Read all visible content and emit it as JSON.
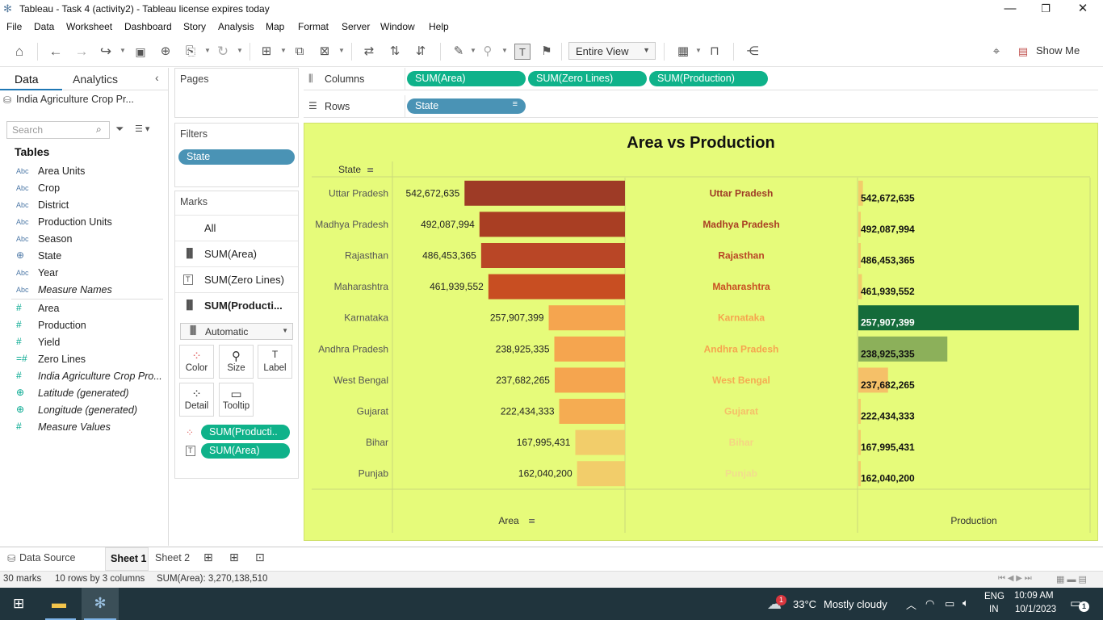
{
  "window": {
    "title": "Tableau - Task 4 (activity2) - Tableau license expires today",
    "minimize_glyph": "—",
    "restore_glyph": "❐",
    "close_glyph": "✕"
  },
  "menu": [
    "File",
    "Data",
    "Worksheet",
    "Dashboard",
    "Story",
    "Analysis",
    "Map",
    "Format",
    "Server",
    "Window",
    "Help"
  ],
  "toolbar": {
    "view_mode": "Entire View",
    "show_me": "Show Me"
  },
  "data_pane": {
    "tab_data": "Data",
    "tab_analytics": "Analytics",
    "datasource": "India Agriculture Crop Pr...",
    "search_placeholder": "Search",
    "tables_heading": "Tables",
    "dimensions": [
      {
        "type": "Abc",
        "name": "Area Units"
      },
      {
        "type": "Abc",
        "name": "Crop"
      },
      {
        "type": "Abc",
        "name": "District"
      },
      {
        "type": "Abc",
        "name": "Production Units"
      },
      {
        "type": "Abc",
        "name": "Season"
      },
      {
        "type": "geo",
        "name": "State"
      },
      {
        "type": "Abc",
        "name": "Year"
      },
      {
        "type": "Abc",
        "name": "Measure Names",
        "italic": true
      }
    ],
    "measures": [
      {
        "type": "#",
        "name": "Area"
      },
      {
        "type": "#",
        "name": "Production"
      },
      {
        "type": "#",
        "name": "Yield"
      },
      {
        "type": "=#",
        "name": "Zero Lines"
      },
      {
        "type": "#",
        "name": "India Agriculture Crop Pro...",
        "italic": true
      },
      {
        "type": "geo",
        "name": "Latitude (generated)",
        "italic": true
      },
      {
        "type": "geo",
        "name": "Longitude (generated)",
        "italic": true
      },
      {
        "type": "#",
        "name": "Measure Values",
        "italic": true
      }
    ]
  },
  "cards": {
    "pages": "Pages",
    "filters": "Filters",
    "filter_pill": "State",
    "marks": "Marks",
    "marks_rows": [
      "All",
      "SUM(Area)",
      "SUM(Zero Lines)",
      "SUM(Producti..."
    ],
    "marks_type": "Automatic",
    "mark_buttons": [
      "Color",
      "Size",
      "Label",
      "Detail",
      "Tooltip"
    ],
    "mark_pills": [
      "SUM(Producti..",
      "SUM(Area)"
    ]
  },
  "shelves": {
    "columns_label": "Columns",
    "rows_label": "Rows",
    "columns_pills": [
      "SUM(Area)",
      "SUM(Zero Lines)",
      "SUM(Production)"
    ],
    "rows_pill": "State"
  },
  "chart_data": {
    "type": "bar",
    "title": "Area vs Production",
    "row_header": "State",
    "categories": [
      "Uttar Pradesh",
      "Madhya Pradesh",
      "Rajasthan",
      "Maharashtra",
      "Karnataka",
      "Andhra Pradesh",
      "West Bengal",
      "Gujarat",
      "Bihar",
      "Punjab"
    ],
    "series": [
      {
        "name": "Area",
        "values": [
          542672635,
          492087994,
          486453365,
          461939552,
          257907399,
          238925335,
          237682265,
          222434333,
          167995431,
          162040200
        ]
      },
      {
        "name": "Production",
        "values": [
          540000000,
          80000000,
          50000000,
          420000000,
          26000000000,
          10500000000,
          3500000000,
          200000000,
          100000000,
          150000000
        ]
      }
    ],
    "data_labels": [
      "542,672,635",
      "492,087,994",
      "486,453,365",
      "461,939,552",
      "257,907,399",
      "238,925,335",
      "237,682,265",
      "222,434,333",
      "167,995,431",
      "162,040,200"
    ],
    "area_colors": [
      "#9e3b26",
      "#a93e23",
      "#b94626",
      "#c84e22",
      "#f5a54f",
      "#f5a54f",
      "#f5a54f",
      "#f5ac52",
      "#f2cd6a",
      "#f2cd6a"
    ],
    "center_label_colors": [
      "#9e3b26",
      "#a93e23",
      "#b94626",
      "#c84e22",
      "#f5a54f",
      "#f5a54f",
      "#f5ac52",
      "#f5c068",
      "#f5d583",
      "#f2dd8e"
    ],
    "production_colors": [
      "#f2cd6a",
      "#f2cd6a",
      "#f2cd6a",
      "#f2cd6a",
      "#146b3a",
      "#8cb05a",
      "#f5c068",
      "#f2cd6a",
      "#f2cd6a",
      "#f2cd6a"
    ],
    "xlabel": "Area",
    "xlabel2": "Production",
    "background": "#e6fb7a"
  },
  "sheets": {
    "datasource_tab": "Data Source",
    "tabs": [
      "Sheet 1",
      "Sheet 2"
    ]
  },
  "status": {
    "marks": "30 marks",
    "rows_cols": "10 rows by 3 columns",
    "sum": "SUM(Area): 3,270,138,510"
  },
  "taskbar": {
    "weather_temp": "33°C",
    "weather_text": "Mostly cloudy",
    "lang1": "ENG",
    "lang2": "IN",
    "time": "10:09 AM",
    "date": "10/1/2023",
    "notification_count": "1"
  }
}
